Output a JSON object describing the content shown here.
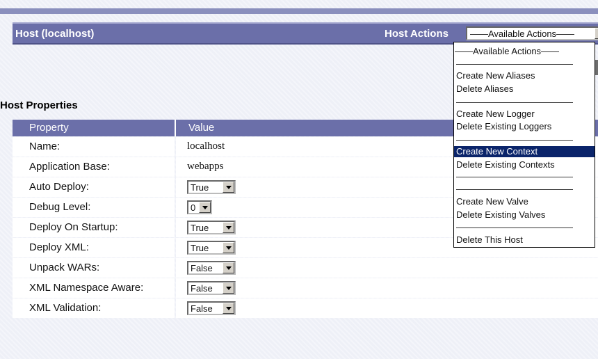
{
  "header": {
    "title": "Host (localhost)",
    "actions_label": "Host Actions",
    "actions_selected": "——Available Actions——"
  },
  "actions_menu": {
    "items": [
      "——Available Actions——",
      "Create New Aliases",
      "Delete Aliases",
      "Create New Logger",
      "Delete Existing Loggers",
      "Create New Context",
      "Delete Existing Contexts",
      "Create New Valve",
      "Delete Existing Valves",
      "Delete This Host"
    ],
    "highlighted": "Create New Context"
  },
  "section": {
    "title": "Host Properties"
  },
  "table": {
    "columns": [
      "Property",
      "Value"
    ],
    "rows": [
      {
        "label": "Name:",
        "value": "localhost",
        "control": "text"
      },
      {
        "label": "Application Base:",
        "value": "webapps",
        "control": "text"
      },
      {
        "label": "Auto Deploy:",
        "value": "True",
        "control": "select"
      },
      {
        "label": "Debug Level:",
        "value": "0",
        "control": "select"
      },
      {
        "label": "Deploy On Startup:",
        "value": "True",
        "control": "select"
      },
      {
        "label": "Deploy XML:",
        "value": "True",
        "control": "select"
      },
      {
        "label": "Unpack WARs:",
        "value": "False",
        "control": "select"
      },
      {
        "label": "XML Namespace Aware:",
        "value": "False",
        "control": "select"
      },
      {
        "label": "XML Validation:",
        "value": "False",
        "control": "select"
      }
    ]
  },
  "colors": {
    "header_bg": "#6b6fa9",
    "selection_bg": "#0a246a",
    "page_bg": "#eef0f7"
  }
}
